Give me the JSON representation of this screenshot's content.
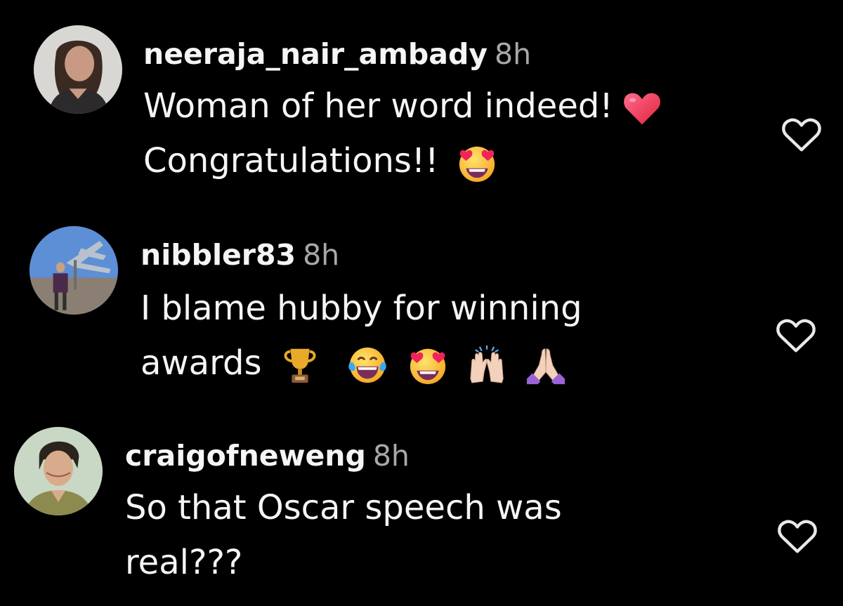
{
  "comments": [
    {
      "username": "neeraja_nair_ambady",
      "time": "8h",
      "line1": "Woman of her word indeed!",
      "line2": "Congratulations!!",
      "emojis_line1": [
        "red-heart-emoji"
      ],
      "emojis_line2": [
        "heart-eyes-emoji"
      ],
      "avatar_icon": "user-avatar-woman",
      "like_icon": "heart-outline-icon"
    },
    {
      "username": "nibbler83",
      "time": "8h",
      "line1": "I blame hubby for winning",
      "line2": "awards",
      "emojis_line2": [
        "trophy-emoji",
        "tears-of-joy-emoji",
        "heart-eyes-emoji",
        "raising-hands-emoji",
        "folded-hands-emoji"
      ],
      "avatar_icon": "user-avatar-sculpture",
      "like_icon": "heart-outline-icon"
    },
    {
      "username": "craigofneweng",
      "time": "8h",
      "line1": "So that Oscar speech was",
      "line2": "real???",
      "avatar_icon": "user-avatar-man",
      "like_icon": "heart-outline-icon"
    }
  ],
  "colors": {
    "background": "#000000",
    "text": "#f5f5f5",
    "secondary_text": "#a8a8a8"
  }
}
